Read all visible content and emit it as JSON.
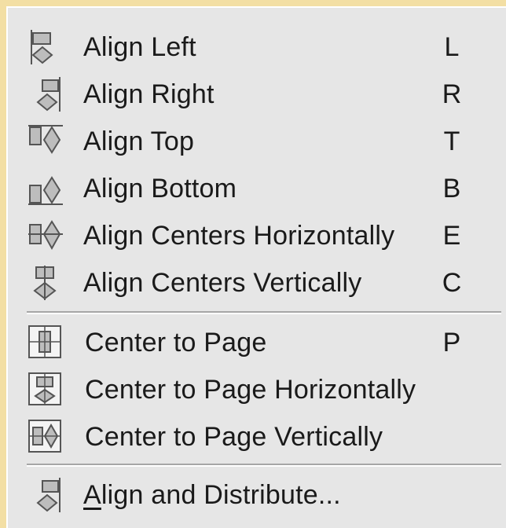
{
  "menu": {
    "items": [
      {
        "label": "Align Left",
        "shortcut": "L",
        "icon": "align-left-icon"
      },
      {
        "label": "Align Right",
        "shortcut": "R",
        "icon": "align-right-icon"
      },
      {
        "label": "Align Top",
        "shortcut": "T",
        "icon": "align-top-icon"
      },
      {
        "label": "Align Bottom",
        "shortcut": "B",
        "icon": "align-bottom-icon"
      },
      {
        "label": "Align Centers Horizontally",
        "shortcut": "E",
        "icon": "align-centers-horizontally-icon"
      },
      {
        "label": "Align Centers Vertically",
        "shortcut": "C",
        "icon": "align-centers-vertically-icon"
      },
      {
        "label": "Center to Page",
        "shortcut": "P",
        "icon": "center-to-page-icon"
      },
      {
        "label": "Center to Page Horizontally",
        "shortcut": "",
        "icon": "center-to-page-horizontally-icon"
      },
      {
        "label": "Center to Page Vertically",
        "shortcut": "",
        "icon": "center-to-page-vertically-icon"
      },
      {
        "label_underlined": "A",
        "label_rest": "lign and Distribute...",
        "shortcut": "",
        "icon": "align-and-distribute-icon"
      }
    ]
  },
  "colors": {
    "menu_bg": "#e6e6e6",
    "desktop_bg": "#f3dfa4",
    "text": "#1a1a1a"
  }
}
